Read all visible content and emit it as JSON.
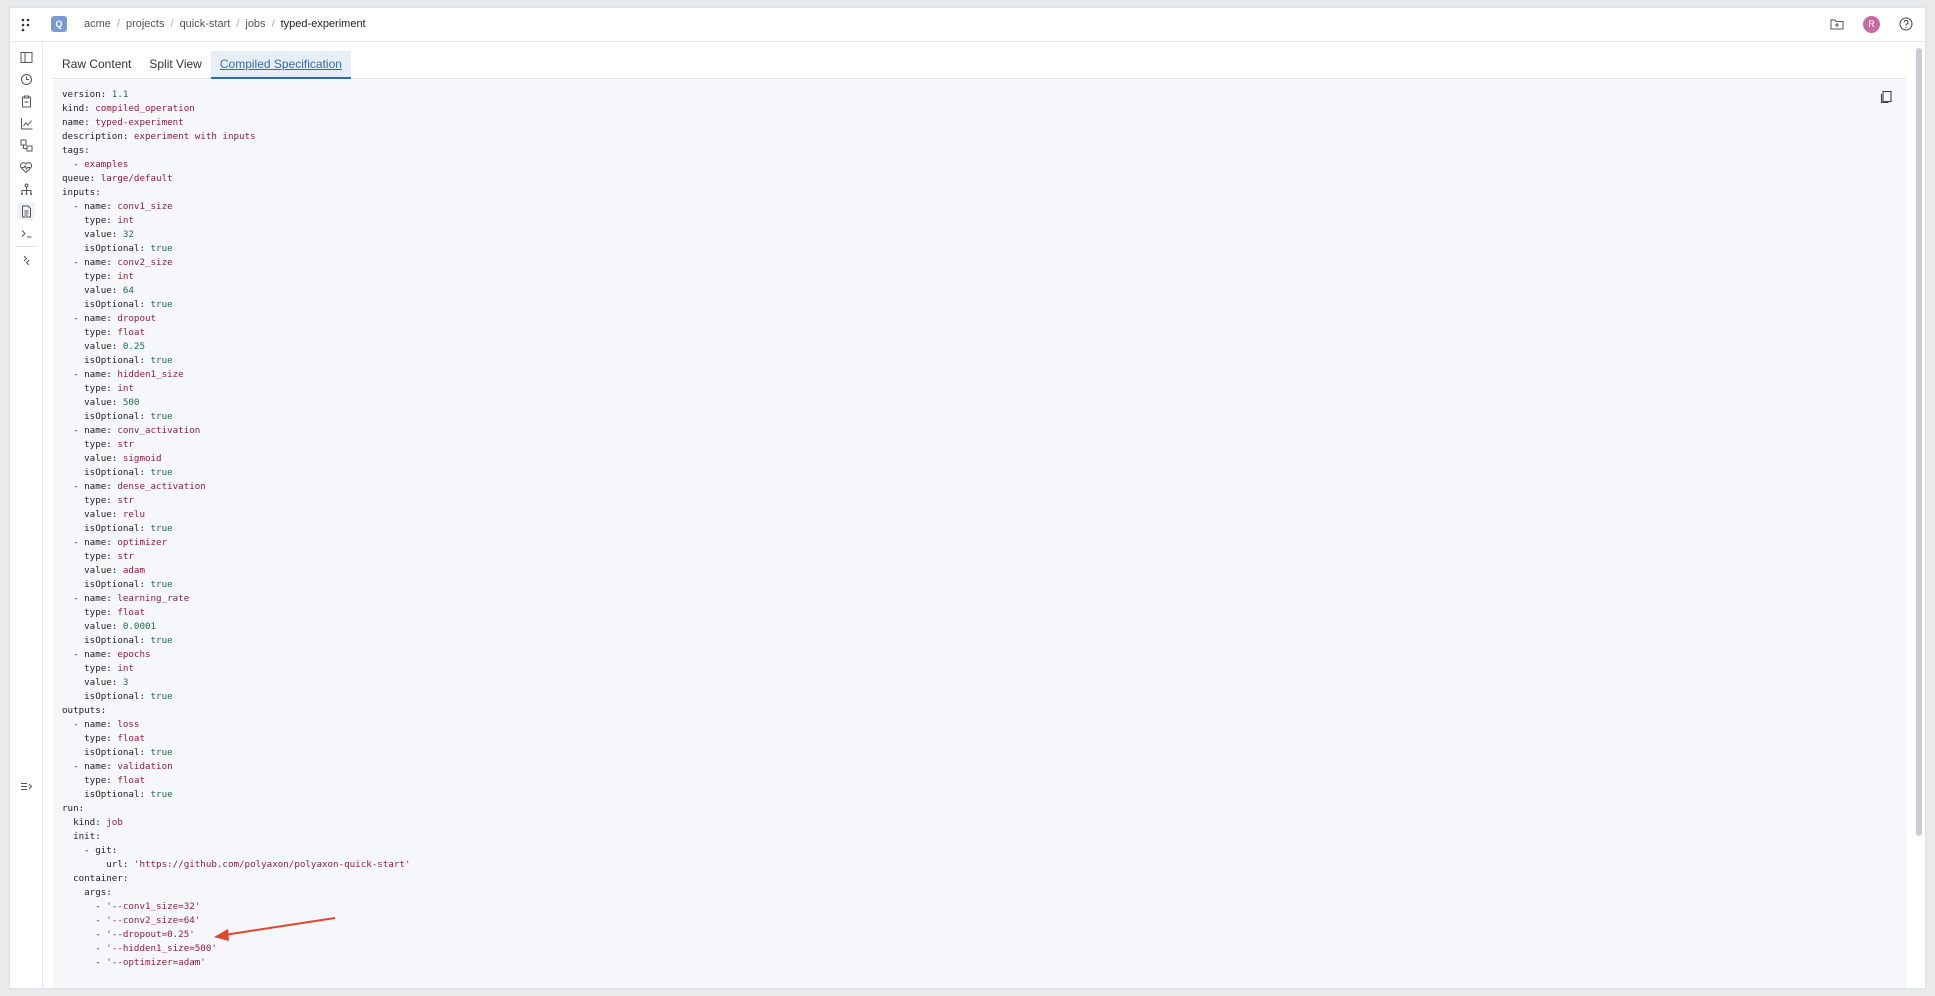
{
  "header": {
    "logo_letter": "Q",
    "breadcrumb": [
      "acme",
      "projects",
      "quick-start",
      "jobs",
      "typed-experiment"
    ],
    "avatar_letter": "R"
  },
  "tabs": [
    {
      "label": "Raw Content",
      "active": false
    },
    {
      "label": "Split View",
      "active": false
    },
    {
      "label": "Compiled Specification",
      "active": true
    }
  ],
  "code_lines": [
    [
      {
        "t": "version: ",
        "c": "k"
      },
      {
        "t": "1.1",
        "c": "num"
      }
    ],
    [
      {
        "t": "kind: ",
        "c": "k"
      },
      {
        "t": "compiled_operation",
        "c": "v"
      }
    ],
    [
      {
        "t": "name: ",
        "c": "k"
      },
      {
        "t": "typed-experiment",
        "c": "v"
      }
    ],
    [
      {
        "t": "description: ",
        "c": "k"
      },
      {
        "t": "experiment with inputs",
        "c": "v"
      }
    ],
    [
      {
        "t": "tags:",
        "c": "k"
      }
    ],
    [
      {
        "t": "  - ",
        "c": "k"
      },
      {
        "t": "examples",
        "c": "v"
      }
    ],
    [
      {
        "t": "queue: ",
        "c": "k"
      },
      {
        "t": "large/default",
        "c": "v"
      }
    ],
    [
      {
        "t": "inputs:",
        "c": "k"
      }
    ],
    [
      {
        "t": "  - name: ",
        "c": "k"
      },
      {
        "t": "conv1_size",
        "c": "v"
      }
    ],
    [
      {
        "t": "    type: ",
        "c": "k"
      },
      {
        "t": "int",
        "c": "v"
      }
    ],
    [
      {
        "t": "    value: ",
        "c": "k"
      },
      {
        "t": "32",
        "c": "num"
      }
    ],
    [
      {
        "t": "    isOptional: ",
        "c": "k"
      },
      {
        "t": "true",
        "c": "bool"
      }
    ],
    [
      {
        "t": "  - name: ",
        "c": "k"
      },
      {
        "t": "conv2_size",
        "c": "v"
      }
    ],
    [
      {
        "t": "    type: ",
        "c": "k"
      },
      {
        "t": "int",
        "c": "v"
      }
    ],
    [
      {
        "t": "    value: ",
        "c": "k"
      },
      {
        "t": "64",
        "c": "num"
      }
    ],
    [
      {
        "t": "    isOptional: ",
        "c": "k"
      },
      {
        "t": "true",
        "c": "bool"
      }
    ],
    [
      {
        "t": "  - name: ",
        "c": "k"
      },
      {
        "t": "dropout",
        "c": "v"
      }
    ],
    [
      {
        "t": "    type: ",
        "c": "k"
      },
      {
        "t": "float",
        "c": "v"
      }
    ],
    [
      {
        "t": "    value: ",
        "c": "k"
      },
      {
        "t": "0.25",
        "c": "num"
      }
    ],
    [
      {
        "t": "    isOptional: ",
        "c": "k"
      },
      {
        "t": "true",
        "c": "bool"
      }
    ],
    [
      {
        "t": "  - name: ",
        "c": "k"
      },
      {
        "t": "hidden1_size",
        "c": "v"
      }
    ],
    [
      {
        "t": "    type: ",
        "c": "k"
      },
      {
        "t": "int",
        "c": "v"
      }
    ],
    [
      {
        "t": "    value: ",
        "c": "k"
      },
      {
        "t": "500",
        "c": "num"
      }
    ],
    [
      {
        "t": "    isOptional: ",
        "c": "k"
      },
      {
        "t": "true",
        "c": "bool"
      }
    ],
    [
      {
        "t": "  - name: ",
        "c": "k"
      },
      {
        "t": "conv_activation",
        "c": "v"
      }
    ],
    [
      {
        "t": "    type: ",
        "c": "k"
      },
      {
        "t": "str",
        "c": "v"
      }
    ],
    [
      {
        "t": "    value: ",
        "c": "k"
      },
      {
        "t": "sigmoid",
        "c": "v"
      }
    ],
    [
      {
        "t": "    isOptional: ",
        "c": "k"
      },
      {
        "t": "true",
        "c": "bool"
      }
    ],
    [
      {
        "t": "  - name: ",
        "c": "k"
      },
      {
        "t": "dense_activation",
        "c": "v"
      }
    ],
    [
      {
        "t": "    type: ",
        "c": "k"
      },
      {
        "t": "str",
        "c": "v"
      }
    ],
    [
      {
        "t": "    value: ",
        "c": "k"
      },
      {
        "t": "relu",
        "c": "v"
      }
    ],
    [
      {
        "t": "    isOptional: ",
        "c": "k"
      },
      {
        "t": "true",
        "c": "bool"
      }
    ],
    [
      {
        "t": "  - name: ",
        "c": "k"
      },
      {
        "t": "optimizer",
        "c": "v"
      }
    ],
    [
      {
        "t": "    type: ",
        "c": "k"
      },
      {
        "t": "str",
        "c": "v"
      }
    ],
    [
      {
        "t": "    value: ",
        "c": "k"
      },
      {
        "t": "adam",
        "c": "v"
      }
    ],
    [
      {
        "t": "    isOptional: ",
        "c": "k"
      },
      {
        "t": "true",
        "c": "bool"
      }
    ],
    [
      {
        "t": "  - name: ",
        "c": "k"
      },
      {
        "t": "learning_rate",
        "c": "v"
      }
    ],
    [
      {
        "t": "    type: ",
        "c": "k"
      },
      {
        "t": "float",
        "c": "v"
      }
    ],
    [
      {
        "t": "    value: ",
        "c": "k"
      },
      {
        "t": "0.0001",
        "c": "num"
      }
    ],
    [
      {
        "t": "    isOptional: ",
        "c": "k"
      },
      {
        "t": "true",
        "c": "bool"
      }
    ],
    [
      {
        "t": "  - name: ",
        "c": "k"
      },
      {
        "t": "epochs",
        "c": "v"
      }
    ],
    [
      {
        "t": "    type: ",
        "c": "k"
      },
      {
        "t": "int",
        "c": "v"
      }
    ],
    [
      {
        "t": "    value: ",
        "c": "k"
      },
      {
        "t": "3",
        "c": "num"
      }
    ],
    [
      {
        "t": "    isOptional: ",
        "c": "k"
      },
      {
        "t": "true",
        "c": "bool"
      }
    ],
    [
      {
        "t": "outputs:",
        "c": "k"
      }
    ],
    [
      {
        "t": "  - name: ",
        "c": "k"
      },
      {
        "t": "loss",
        "c": "v"
      }
    ],
    [
      {
        "t": "    type: ",
        "c": "k"
      },
      {
        "t": "float",
        "c": "v"
      }
    ],
    [
      {
        "t": "    isOptional: ",
        "c": "k"
      },
      {
        "t": "true",
        "c": "bool"
      }
    ],
    [
      {
        "t": "  - name: ",
        "c": "k"
      },
      {
        "t": "validation",
        "c": "v"
      }
    ],
    [
      {
        "t": "    type: ",
        "c": "k"
      },
      {
        "t": "float",
        "c": "v"
      }
    ],
    [
      {
        "t": "    isOptional: ",
        "c": "k"
      },
      {
        "t": "true",
        "c": "bool"
      }
    ],
    [
      {
        "t": "run:",
        "c": "k"
      }
    ],
    [
      {
        "t": "  kind: ",
        "c": "k"
      },
      {
        "t": "job",
        "c": "v"
      }
    ],
    [
      {
        "t": "  init:",
        "c": "k"
      }
    ],
    [
      {
        "t": "    - git:",
        "c": "k"
      }
    ],
    [
      {
        "t": "        url: ",
        "c": "k"
      },
      {
        "t": "'https://github.com/polyaxon/polyaxon-quick-start'",
        "c": "v"
      }
    ],
    [
      {
        "t": "  container:",
        "c": "k"
      }
    ],
    [
      {
        "t": "    args:",
        "c": "k"
      }
    ],
    [
      {
        "t": "      - ",
        "c": "k"
      },
      {
        "t": "'--conv1_size=32'",
        "c": "v"
      }
    ],
    [
      {
        "t": "      - ",
        "c": "k"
      },
      {
        "t": "'--conv2_size=64'",
        "c": "v"
      }
    ],
    [
      {
        "t": "      - ",
        "c": "k"
      },
      {
        "t": "'--dropout=0.25'",
        "c": "v"
      }
    ],
    [
      {
        "t": "      - ",
        "c": "k"
      },
      {
        "t": "'--hidden1_size=500'",
        "c": "v"
      }
    ],
    [
      {
        "t": "      - ",
        "c": "k"
      },
      {
        "t": "'--optimizer=adam'",
        "c": "v"
      }
    ]
  ],
  "annotation_color": "#e0452e"
}
